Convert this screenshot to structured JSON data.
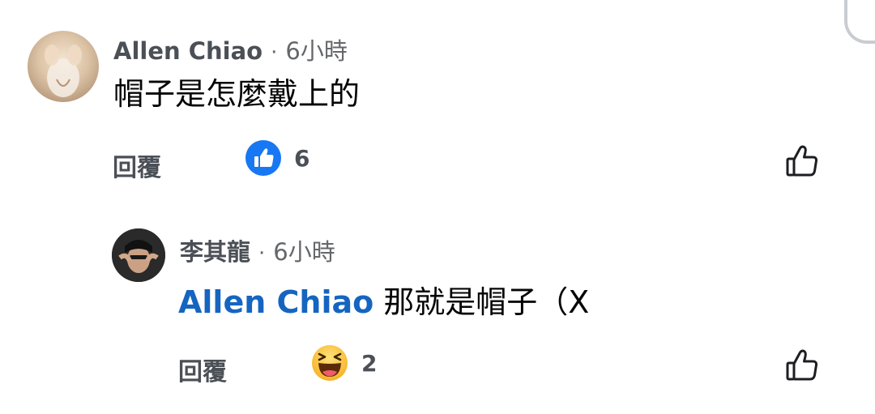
{
  "comments": [
    {
      "author": "Allen Chiao",
      "separator": "·",
      "time": "6小時",
      "text": "帽子是怎麼戴上的",
      "reply_label": "回覆",
      "reaction_type": "like-reaction-icon",
      "reaction_count": "6"
    },
    {
      "author": "李其龍",
      "separator": "·",
      "time": "6小時",
      "mention": "Allen Chiao",
      "text": "那就是帽子（X",
      "reply_label": "回覆",
      "reaction_type": "haha-reaction-icon",
      "reaction_count": "2"
    }
  ],
  "colors": {
    "like_blue": "#1877f2",
    "mention_blue": "#1565c0",
    "haha_yellow": "#f7b125",
    "meta_gray": "#65676b"
  }
}
